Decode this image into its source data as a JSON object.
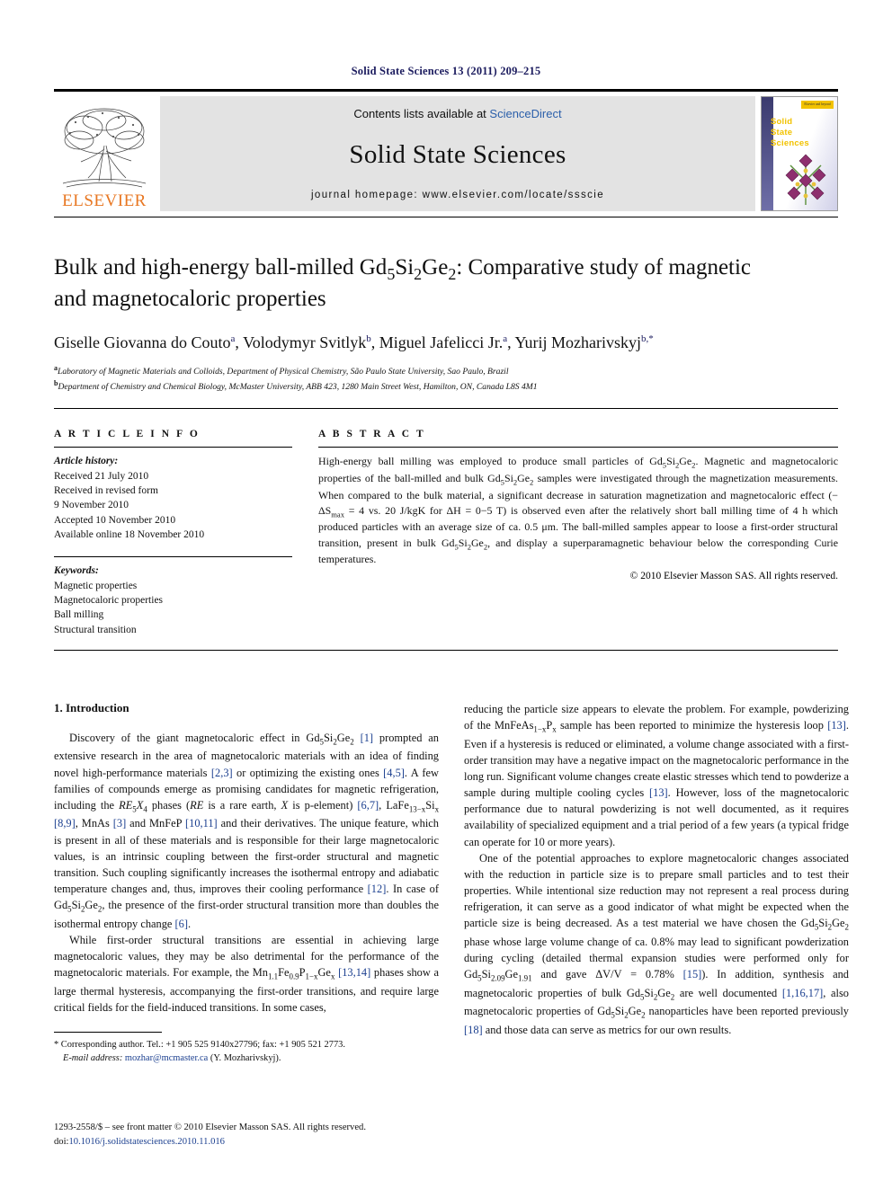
{
  "running_head": "Solid State Sciences 13 (2011) 209–215",
  "masthead": {
    "publisher_logo_label": "ELSEVIER",
    "contents_prefix": "Contents lists available at ",
    "contents_link": "ScienceDirect",
    "journal_name": "Solid State Sciences",
    "homepage_label": "journal homepage: www.elsevier.com/locate/ssscie",
    "cover": {
      "line1": "Solid",
      "line2": "State",
      "line3": "Sciences",
      "tag": "Elsevier and beyond"
    }
  },
  "article": {
    "title_line1": "Bulk and high-energy ball-milled Gd₅Si₂Ge₂: Comparative study of magnetic",
    "title_line2": "and magnetocaloric properties",
    "authors_plain": "Giselle Giovanna do Couto a, Volodymyr Svitlyk b, Miguel Jafelicci Jr. a, Yurij Mozharivskyj b,*",
    "authors": [
      {
        "name": "Giselle Giovanna do Couto",
        "mark": "a"
      },
      {
        "name": "Volodymyr Svitlyk",
        "mark": "b"
      },
      {
        "name": "Miguel Jafelicci Jr.",
        "mark": "a"
      },
      {
        "name": "Yurij Mozharivskyj",
        "mark": "b,*"
      }
    ],
    "affiliations": [
      {
        "mark": "a",
        "text": "Laboratory of Magnetic Materials and Colloids, Department of Physical Chemistry, São Paulo State University, Sao Paulo, Brazil"
      },
      {
        "mark": "b",
        "text": "Department of Chemistry and Chemical Biology, McMaster University, ABB 423, 1280 Main Street West, Hamilton, ON, Canada L8S 4M1"
      }
    ]
  },
  "article_info": {
    "heading": "A R T I C L E   I N F O",
    "history_label": "Article history:",
    "history": [
      "Received 21 July 2010",
      "Received in revised form",
      "9 November 2010",
      "Accepted 10 November 2010",
      "Available online 18 November 2010"
    ],
    "keywords_label": "Keywords:",
    "keywords": [
      "Magnetic properties",
      "Magnetocaloric properties",
      "Ball milling",
      "Structural transition"
    ]
  },
  "abstract": {
    "heading": "A B S T R A C T",
    "text_html": "High-energy ball milling was employed to produce small particles of Gd<sub>5</sub>Si<sub>2</sub>Ge<sub>2</sub>. Magnetic and magnetocaloric properties of the ball-milled and bulk Gd<sub>5</sub>Si<sub>2</sub>Ge<sub>2</sub> samples were investigated through the magnetization measurements. When compared to the bulk material, a significant decrease in saturation magnetization and magnetocaloric effect (&minus; ΔS<sub>max</sub> = 4 vs. 20 J/kgK for ΔH = 0−5 T) is observed even after the relatively short ball milling time of 4 h which produced particles with an average size of ca. 0.5 μm. The ball-milled samples appear to loose a first-order structural transition, present in bulk Gd<sub>5</sub>Si<sub>2</sub>Ge<sub>2</sub>, and display a superparamagnetic behaviour below the corresponding Curie temperatures.",
    "copyright": "© 2010 Elsevier Masson SAS. All rights reserved."
  },
  "body": {
    "section_title": "1.  Introduction",
    "left_paragraphs_html": [
      "Discovery of the giant magnetocaloric effect in Gd<sub>5</sub>Si<sub>2</sub>Ge<sub>2</sub> <span class=\"ref\">[1]</span> prompted an extensive research in the area of magnetocaloric materials with an idea of finding novel high-performance materials <span class=\"ref\">[2,3]</span> or optimizing the existing ones <span class=\"ref\">[4,5]</span>. A few families of compounds emerge as promising candidates for magnetic refrigeration, including the <i>RE</i><sub>5</sub><i>X</i><sub>4</sub> phases (<i>RE</i> is a rare earth, <i>X</i> is p-element) <span class=\"ref\">[6,7]</span>, LaFe<sub>13−x</sub>Si<sub>x</sub> <span class=\"ref\">[8,9]</span>, MnAs <span class=\"ref\">[3]</span> and MnFeP <span class=\"ref\">[10,11]</span> and their derivatives. The unique feature, which is present in all of these materials and is responsible for their large magnetocaloric values, is an intrinsic coupling between the first-order structural and magnetic transition. Such coupling significantly increases the isothermal entropy and adiabatic temperature changes and, thus, improves their cooling performance <span class=\"ref\">[12]</span>. In case of Gd<sub>5</sub>Si<sub>2</sub>Ge<sub>2</sub>, the presence of the first-order structural transition more than doubles the isothermal entropy change <span class=\"ref\">[6]</span>.",
      "While first-order structural transitions are essential in achieving large magnetocaloric values, they may be also detrimental for the performance of the magnetocaloric materials. For example, the Mn<sub>1.1</sub>Fe<sub>0.9</sub>P<sub>1−x</sub>Ge<sub>x</sub> <span class=\"ref\">[13,14]</span> phases show a large thermal hysteresis, accompanying the first-order transitions, and require large critical fields for the field-induced transitions. In some cases,"
    ],
    "right_paragraphs_html": [
      "reducing the particle size appears to elevate the problem. For example, powderizing of the MnFeAs<sub>1−x</sub>P<sub>x</sub> sample has been reported to minimize the hysteresis loop <span class=\"ref\">[13]</span>. Even if a hysteresis is reduced or eliminated, a volume change associated with a first-order transition may have a negative impact on the magnetocaloric performance in the long run. Significant volume changes create elastic stresses which tend to powderize a sample during multiple cooling cycles <span class=\"ref\">[13]</span>. However, loss of the magnetocaloric performance due to natural powderizing is not well documented, as it requires availability of specialized equipment and a trial period of a few years (a typical fridge can operate for 10 or more years).",
      "One of the potential approaches to explore magnetocaloric changes associated with the reduction in particle size is to prepare small particles and to test their properties. While intentional size reduction may not represent a real process during refrigeration, it can serve as a good indicator of what might be expected when the particle size is being decreased. As a test material we have chosen the Gd<sub>5</sub>Si<sub>2</sub>Ge<sub>2</sub> phase whose large volume change of ca. 0.8% may lead to significant powderization during cycling (detailed thermal expansion studies were performed only for Gd<sub>5</sub>Si<sub>2.09</sub>Ge<sub>1.91</sub> and gave ΔV/V = 0.78% <span class=\"ref\">[15]</span>). In addition, synthesis and magnetocaloric properties of bulk Gd<sub>5</sub>Si<sub>2</sub>Ge<sub>2</sub> are well documented <span class=\"ref\">[1,16,17]</span>, also magnetocaloric properties of Gd<sub>5</sub>Si<sub>2</sub>Ge<sub>2</sub> nanoparticles have been reported previously <span class=\"ref\">[18]</span> and those data can serve as metrics for our own results."
    ]
  },
  "footnote": {
    "line1": "*  Corresponding author. Tel.: +1 905 525 9140x27796; fax: +1 905 521 2773.",
    "email_label": "E-mail address:",
    "email": "mozhar@mcmaster.ca",
    "email_suffix": "(Y. Mozharivskyj)."
  },
  "frontmatter": {
    "line1": "1293-2558/$ – see front matter © 2010 Elsevier Masson SAS. All rights reserved.",
    "doi_label": "doi:",
    "doi": "10.1016/j.solidstatesciences.2010.11.016"
  },
  "colors": {
    "running_head": "#1b1b5e",
    "link": "#1b3f8f",
    "banner_bg": "#e3e3e3",
    "elsevier_orange": "#E87722",
    "cover_yellow": "#f2c200"
  }
}
